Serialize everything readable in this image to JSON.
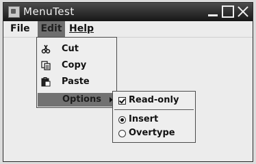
{
  "window": {
    "title": "MenuTest"
  },
  "menubar": {
    "file": "File",
    "edit": "Edit",
    "help": "Help"
  },
  "edit_menu": {
    "cut": {
      "label": "Cut",
      "icon": "scissors-icon"
    },
    "copy": {
      "label": "Copy",
      "icon": "copy-icon"
    },
    "paste": {
      "label": "Paste",
      "icon": "paste-icon"
    },
    "options": {
      "label": "Options"
    }
  },
  "options_menu": {
    "read_only": {
      "label": "Read-only",
      "checked": true
    },
    "insert": {
      "label": "Insert",
      "selected": true
    },
    "overtype": {
      "label": "Overtype",
      "selected": false
    }
  }
}
